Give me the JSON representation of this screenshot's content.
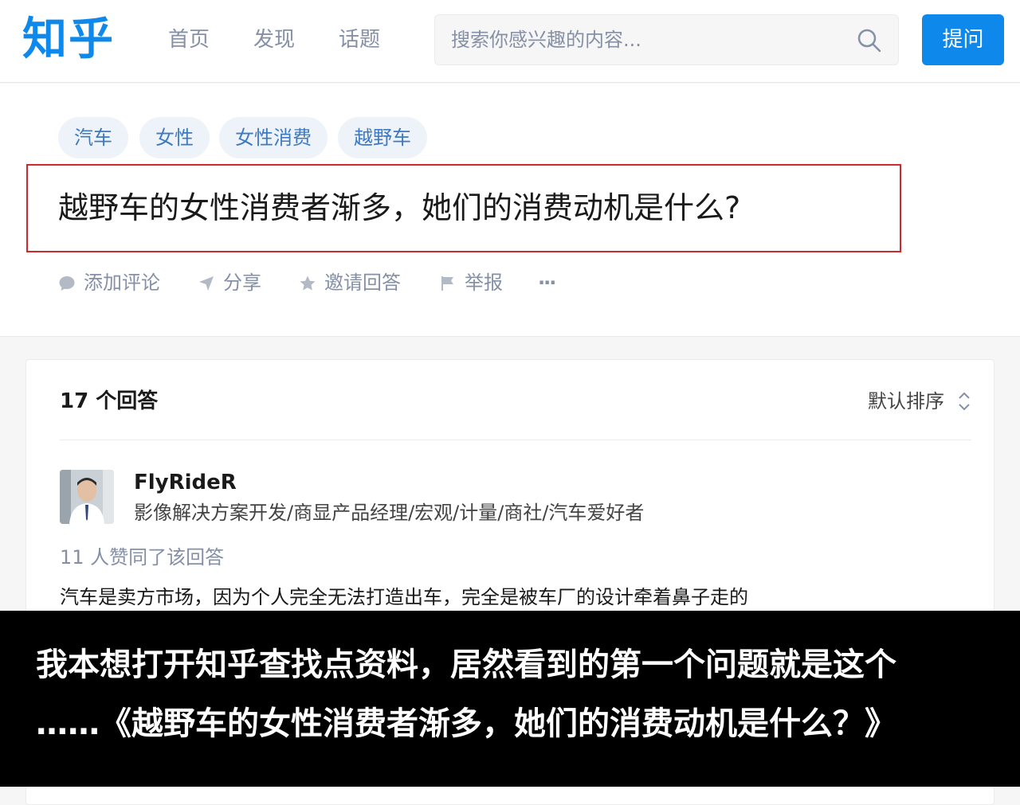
{
  "header": {
    "logo": "知乎",
    "nav": [
      "首页",
      "发现",
      "话题"
    ],
    "search_placeholder": "搜索你感兴趣的内容...",
    "ask_label": "提问",
    "brand_color": "#0f88eb"
  },
  "question": {
    "topics": [
      "汽车",
      "女性",
      "女性消费",
      "越野车"
    ],
    "title": "越野车的女性消费者渐多，她们的消费动机是什么?",
    "actions": [
      {
        "label": "添加评论",
        "icon": "comment-icon"
      },
      {
        "label": "分享",
        "icon": "share-icon"
      },
      {
        "label": "邀请回答",
        "icon": "star-icon"
      },
      {
        "label": "举报",
        "icon": "flag-icon"
      }
    ],
    "more_label": "···",
    "highlight_color": "#d0282f"
  },
  "answers": {
    "count_label": "17 个回答",
    "sort_label": "默认排序",
    "first": {
      "author": "FlyRideR",
      "bio": "影像解决方案开发/商显产品经理/宏观/计量/商社/汽车爱好者",
      "votes": "11 人赞同了该回答",
      "text": "汽车是卖方市场，因为个人完全无法打造出车，完全是被车厂的设计牵着鼻子走的"
    }
  },
  "caption": {
    "line1": "我本想打开知乎查找点资料，居然看到的第一个问题就是这个",
    "line2": "……《越野车的女性消费者渐多，她们的消费动机是什么？》"
  }
}
